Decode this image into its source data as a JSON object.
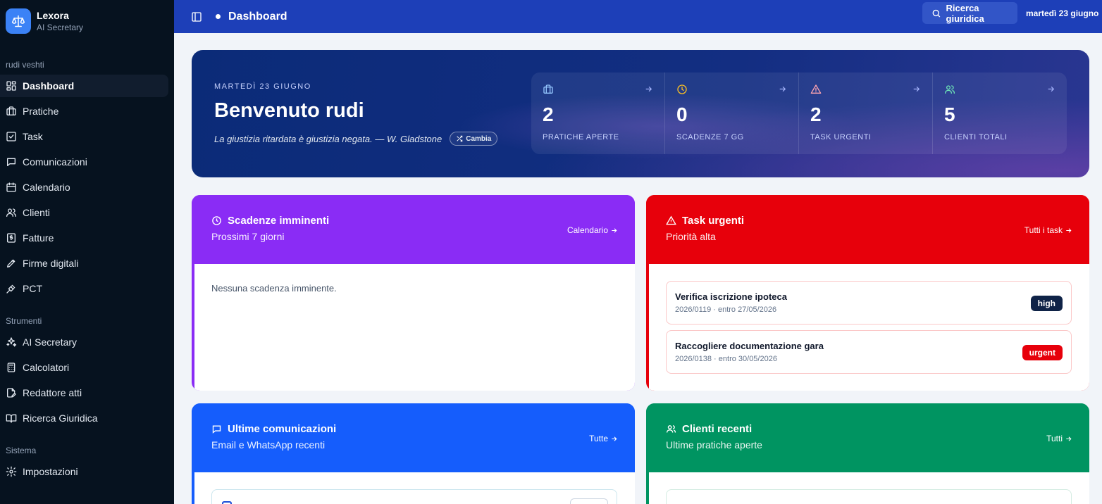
{
  "brand": {
    "name": "Lexora",
    "subtitle": "AI Secretary"
  },
  "sidebar": {
    "user_label": "rudi veshti",
    "main_items": [
      {
        "label": "Dashboard",
        "icon": "dashboard-icon",
        "active": true
      },
      {
        "label": "Pratiche",
        "icon": "briefcase-icon"
      },
      {
        "label": "Task",
        "icon": "checkbox-icon"
      },
      {
        "label": "Comunicazioni",
        "icon": "message-icon"
      },
      {
        "label": "Calendario",
        "icon": "calendar-icon"
      },
      {
        "label": "Clienti",
        "icon": "users-icon"
      },
      {
        "label": "Fatture",
        "icon": "invoice-icon"
      },
      {
        "label": "Firme digitali",
        "icon": "pen-icon"
      },
      {
        "label": "PCT",
        "icon": "gavel-icon"
      }
    ],
    "tools_label": "Strumenti",
    "tools_items": [
      {
        "label": "AI Secretary",
        "icon": "sparkles-icon"
      },
      {
        "label": "Calcolatori",
        "icon": "calculator-icon"
      },
      {
        "label": "Redattore atti",
        "icon": "document-edit-icon"
      },
      {
        "label": "Ricerca Giuridica",
        "icon": "book-icon"
      }
    ],
    "system_label": "Sistema",
    "system_items": [
      {
        "label": "Impostazioni",
        "icon": "gear-icon"
      }
    ]
  },
  "topbar": {
    "title": "Dashboard",
    "search_label": "Ricerca giuridica",
    "date": "martedì 23 giugno"
  },
  "hero": {
    "date": "MARTEDÌ 23 GIUGNO",
    "title": "Benvenuto rudi",
    "quote": "La giustizia ritardata è giustizia negata. — W. Gladstone",
    "change_label": "Cambia",
    "stats": [
      {
        "value": "2",
        "label": "PRATICHE APERTE",
        "icon": "briefcase-icon",
        "color": "#93c5fd"
      },
      {
        "value": "0",
        "label": "SCADENZE 7 GG",
        "icon": "clock-icon",
        "color": "#fbbf24"
      },
      {
        "value": "2",
        "label": "TASK URGENTI",
        "icon": "alert-icon",
        "color": "#fda4af"
      },
      {
        "value": "5",
        "label": "CLIENTI TOTALI",
        "icon": "users-icon",
        "color": "#6ee7b7"
      }
    ]
  },
  "cards": {
    "deadlines": {
      "title": "Scadenze imminenti",
      "subtitle": "Prossimi 7 giorni",
      "link": "Calendario",
      "empty": "Nessuna scadenza imminente.",
      "color": "#8a2cf5"
    },
    "urgent": {
      "title": "Task urgenti",
      "subtitle": "Priorità alta",
      "link": "Tutti i task",
      "color": "#e7000b",
      "tasks": [
        {
          "title": "Verifica iscrizione ipoteca",
          "meta": "2026/0119 · entro 27/05/2026",
          "badge": "high",
          "badge_color": "#0f2347"
        },
        {
          "title": "Raccogliere documentazione gara",
          "meta": "2026/0138 · entro 30/05/2026",
          "badge": "urgent",
          "badge_color": "#e7000b"
        }
      ]
    },
    "comms": {
      "title": "Ultime comunicazioni",
      "subtitle": "Email e WhatsApp recenti",
      "link": "Tutte",
      "color": "#155dfc"
    },
    "clients": {
      "title": "Clienti recenti",
      "subtitle": "Ultime pratiche aperte",
      "link": "Tutti",
      "color": "#009461"
    }
  }
}
